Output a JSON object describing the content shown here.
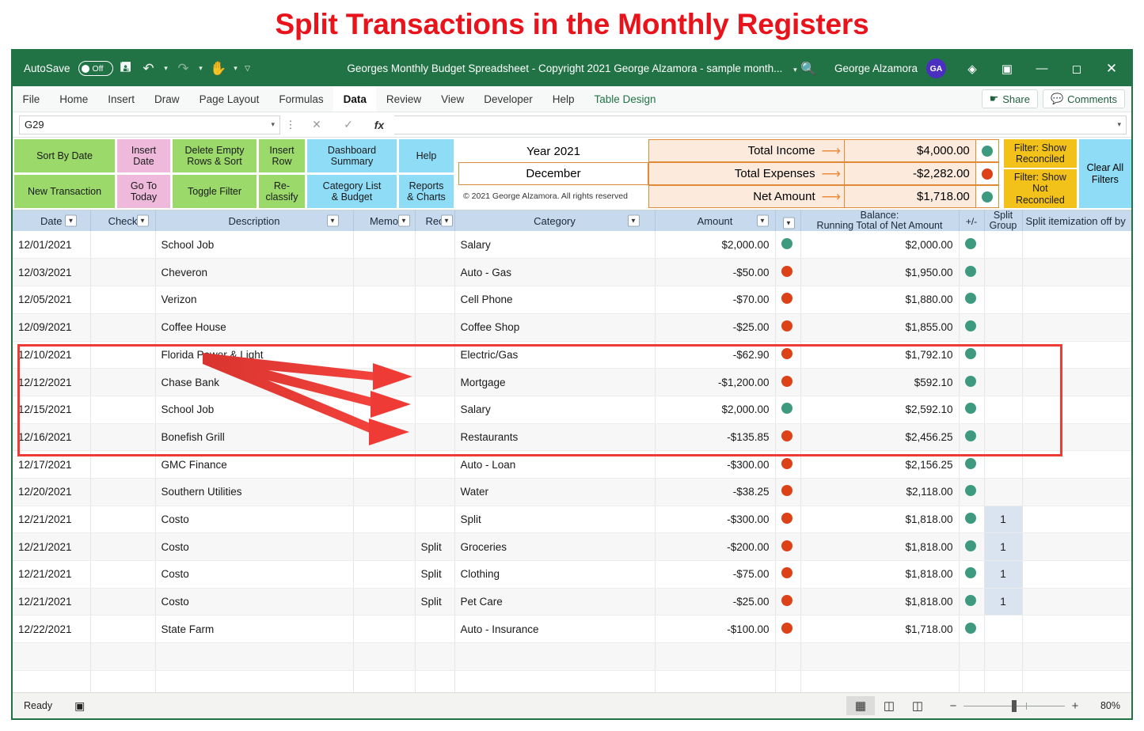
{
  "banner": {
    "title": "Split Transactions in the Monthly Registers"
  },
  "titlebar": {
    "autosave_label": "AutoSave",
    "autosave_state": "Off",
    "document_title": "Georges Monthly Budget Spreadsheet - Copyright 2021 George Alzamora - sample month...",
    "user_name": "George Alzamora",
    "user_initials": "GA",
    "brand_color": "#217346"
  },
  "ribbon": {
    "tabs": [
      "File",
      "Home",
      "Insert",
      "Draw",
      "Page Layout",
      "Formulas",
      "Data",
      "Review",
      "View",
      "Developer",
      "Help",
      "Table Design"
    ],
    "active_tab": "Data",
    "share_label": "Share",
    "comments_label": "Comments"
  },
  "formula_bar": {
    "name_box_value": "G29",
    "formula_value": ""
  },
  "toolbar": {
    "groups": [
      {
        "color": "green",
        "buttons": [
          "Sort By Date",
          "New Transaction"
        ]
      },
      {
        "color": "pink",
        "buttons": [
          "Insert\nDate",
          "Go To\nToday"
        ]
      },
      {
        "color": "green",
        "buttons": [
          "Delete Empty\nRows & Sort",
          "Toggle Filter"
        ]
      },
      {
        "color": "green",
        "buttons": [
          "Insert\nRow",
          "Re-\nclassify"
        ]
      },
      {
        "color": "blue",
        "buttons": [
          "Dashboard\nSummary",
          "Category List\n& Budget"
        ]
      },
      {
        "color": "blue",
        "buttons": [
          "Help",
          "Reports\n& Charts"
        ]
      }
    ],
    "filter_reconciled": "Filter: Show\nReconciled",
    "filter_not_reconciled": "Filter: Show\nNot Reconciled",
    "clear_all_filters": "Clear All\nFilters"
  },
  "summary": {
    "year": "Year 2021",
    "month": "December",
    "copyright": "© 2021 George Alzamora. All rights reserved",
    "rows": [
      {
        "label": "Total Income",
        "value": "$4,000.00",
        "dot": "green"
      },
      {
        "label": "Total Expenses",
        "value": "-$2,282.00",
        "dot": "red"
      },
      {
        "label": "Net Amount",
        "value": "$1,718.00",
        "dot": "green"
      }
    ]
  },
  "table": {
    "headers": [
      "Date",
      "Check",
      "Description",
      "Memo",
      "Rec",
      "Category",
      "Amount",
      "+/-",
      "Balance:\nRunning Total of Net Amount",
      "+/-",
      "Split\nGroup",
      "Split itemization off by"
    ],
    "header_balance_line1": "Balance:",
    "header_balance_line2": "Running Total of Net Amount",
    "header_split_line1": "Split",
    "header_split_line2": "Group",
    "header_plusminus_small": "+/-",
    "rows": [
      {
        "date": "12/01/2021",
        "check": "",
        "description": "School Job",
        "memo": "",
        "rec": "",
        "category": "Salary",
        "amount": "$2,000.00",
        "amount_dot": "green",
        "balance": "$2,000.00",
        "balance_dot": "green",
        "split_group": "",
        "split_off": ""
      },
      {
        "date": "12/03/2021",
        "check": "",
        "description": "Cheveron",
        "memo": "",
        "rec": "",
        "category": "Auto - Gas",
        "amount": "-$50.00",
        "amount_dot": "red",
        "balance": "$1,950.00",
        "balance_dot": "green",
        "split_group": "",
        "split_off": ""
      },
      {
        "date": "12/05/2021",
        "check": "",
        "description": "Verizon",
        "memo": "",
        "rec": "",
        "category": "Cell Phone",
        "amount": "-$70.00",
        "amount_dot": "red",
        "balance": "$1,880.00",
        "balance_dot": "green",
        "split_group": "",
        "split_off": ""
      },
      {
        "date": "12/09/2021",
        "check": "",
        "description": "Coffee House",
        "memo": "",
        "rec": "",
        "category": "Coffee Shop",
        "amount": "-$25.00",
        "amount_dot": "red",
        "balance": "$1,855.00",
        "balance_dot": "green",
        "split_group": "",
        "split_off": ""
      },
      {
        "date": "12/10/2021",
        "check": "",
        "description": "Florida Power & Light",
        "memo": "",
        "rec": "",
        "category": "Electric/Gas",
        "amount": "-$62.90",
        "amount_dot": "red",
        "balance": "$1,792.10",
        "balance_dot": "green",
        "split_group": "",
        "split_off": ""
      },
      {
        "date": "12/12/2021",
        "check": "",
        "description": "Chase Bank",
        "memo": "",
        "rec": "",
        "category": "Mortgage",
        "amount": "-$1,200.00",
        "amount_dot": "red",
        "balance": "$592.10",
        "balance_dot": "green",
        "split_group": "",
        "split_off": ""
      },
      {
        "date": "12/15/2021",
        "check": "",
        "description": "School Job",
        "memo": "",
        "rec": "",
        "category": "Salary",
        "amount": "$2,000.00",
        "amount_dot": "green",
        "balance": "$2,592.10",
        "balance_dot": "green",
        "split_group": "",
        "split_off": ""
      },
      {
        "date": "12/16/2021",
        "check": "",
        "description": "Bonefish Grill",
        "memo": "",
        "rec": "",
        "category": "Restaurants",
        "amount": "-$135.85",
        "amount_dot": "red",
        "balance": "$2,456.25",
        "balance_dot": "green",
        "split_group": "",
        "split_off": ""
      },
      {
        "date": "12/17/2021",
        "check": "",
        "description": "GMC Finance",
        "memo": "",
        "rec": "",
        "category": "Auto - Loan",
        "amount": "-$300.00",
        "amount_dot": "red",
        "balance": "$2,156.25",
        "balance_dot": "green",
        "split_group": "",
        "split_off": ""
      },
      {
        "date": "12/20/2021",
        "check": "",
        "description": "Southern Utilities",
        "memo": "",
        "rec": "",
        "category": "Water",
        "amount": "-$38.25",
        "amount_dot": "red",
        "balance": "$2,118.00",
        "balance_dot": "green",
        "split_group": "",
        "split_off": ""
      },
      {
        "date": "12/21/2021",
        "check": "",
        "description": "Costo",
        "memo": "",
        "rec": "",
        "category": "Split",
        "amount": "-$300.00",
        "amount_dot": "red",
        "balance": "$1,818.00",
        "balance_dot": "green",
        "split_group": "1",
        "split_off": ""
      },
      {
        "date": "12/21/2021",
        "check": "",
        "description": "Costo",
        "memo": "",
        "rec": "Split",
        "category": "Groceries",
        "amount": "-$200.00",
        "amount_dot": "red",
        "balance": "$1,818.00",
        "balance_dot": "green",
        "split_group": "1",
        "split_off": ""
      },
      {
        "date": "12/21/2021",
        "check": "",
        "description": "Costo",
        "memo": "",
        "rec": "Split",
        "category": "Clothing",
        "amount": "-$75.00",
        "amount_dot": "red",
        "balance": "$1,818.00",
        "balance_dot": "green",
        "split_group": "1",
        "split_off": ""
      },
      {
        "date": "12/21/2021",
        "check": "",
        "description": "Costo",
        "memo": "",
        "rec": "Split",
        "category": "Pet Care",
        "amount": "-$25.00",
        "amount_dot": "red",
        "balance": "$1,818.00",
        "balance_dot": "green",
        "split_group": "1",
        "split_off": ""
      },
      {
        "date": "12/22/2021",
        "check": "",
        "description": "State Farm",
        "memo": "",
        "rec": "",
        "category": "Auto - Insurance",
        "amount": "-$100.00",
        "amount_dot": "red",
        "balance": "$1,718.00",
        "balance_dot": "green",
        "split_group": "",
        "split_off": ""
      },
      {
        "date": "",
        "check": "",
        "description": "",
        "memo": "",
        "rec": "",
        "category": "",
        "amount": "",
        "amount_dot": "",
        "balance": "",
        "balance_dot": "",
        "split_group": "",
        "split_off": ""
      },
      {
        "date": "",
        "check": "",
        "description": "",
        "memo": "",
        "rec": "",
        "category": "",
        "amount": "",
        "amount_dot": "",
        "balance": "",
        "balance_dot": "",
        "split_group": "",
        "split_off": ""
      }
    ]
  },
  "statusbar": {
    "status": "Ready",
    "zoom": "80%"
  },
  "colors": {
    "green_dot": "#3e9a7e",
    "red_dot": "#dd4118",
    "highlight_border": "#ef3b36",
    "arrow": "#ee3a35",
    "header_blue": "#c7d9ed",
    "split_group_bg": "#dae3f0"
  }
}
